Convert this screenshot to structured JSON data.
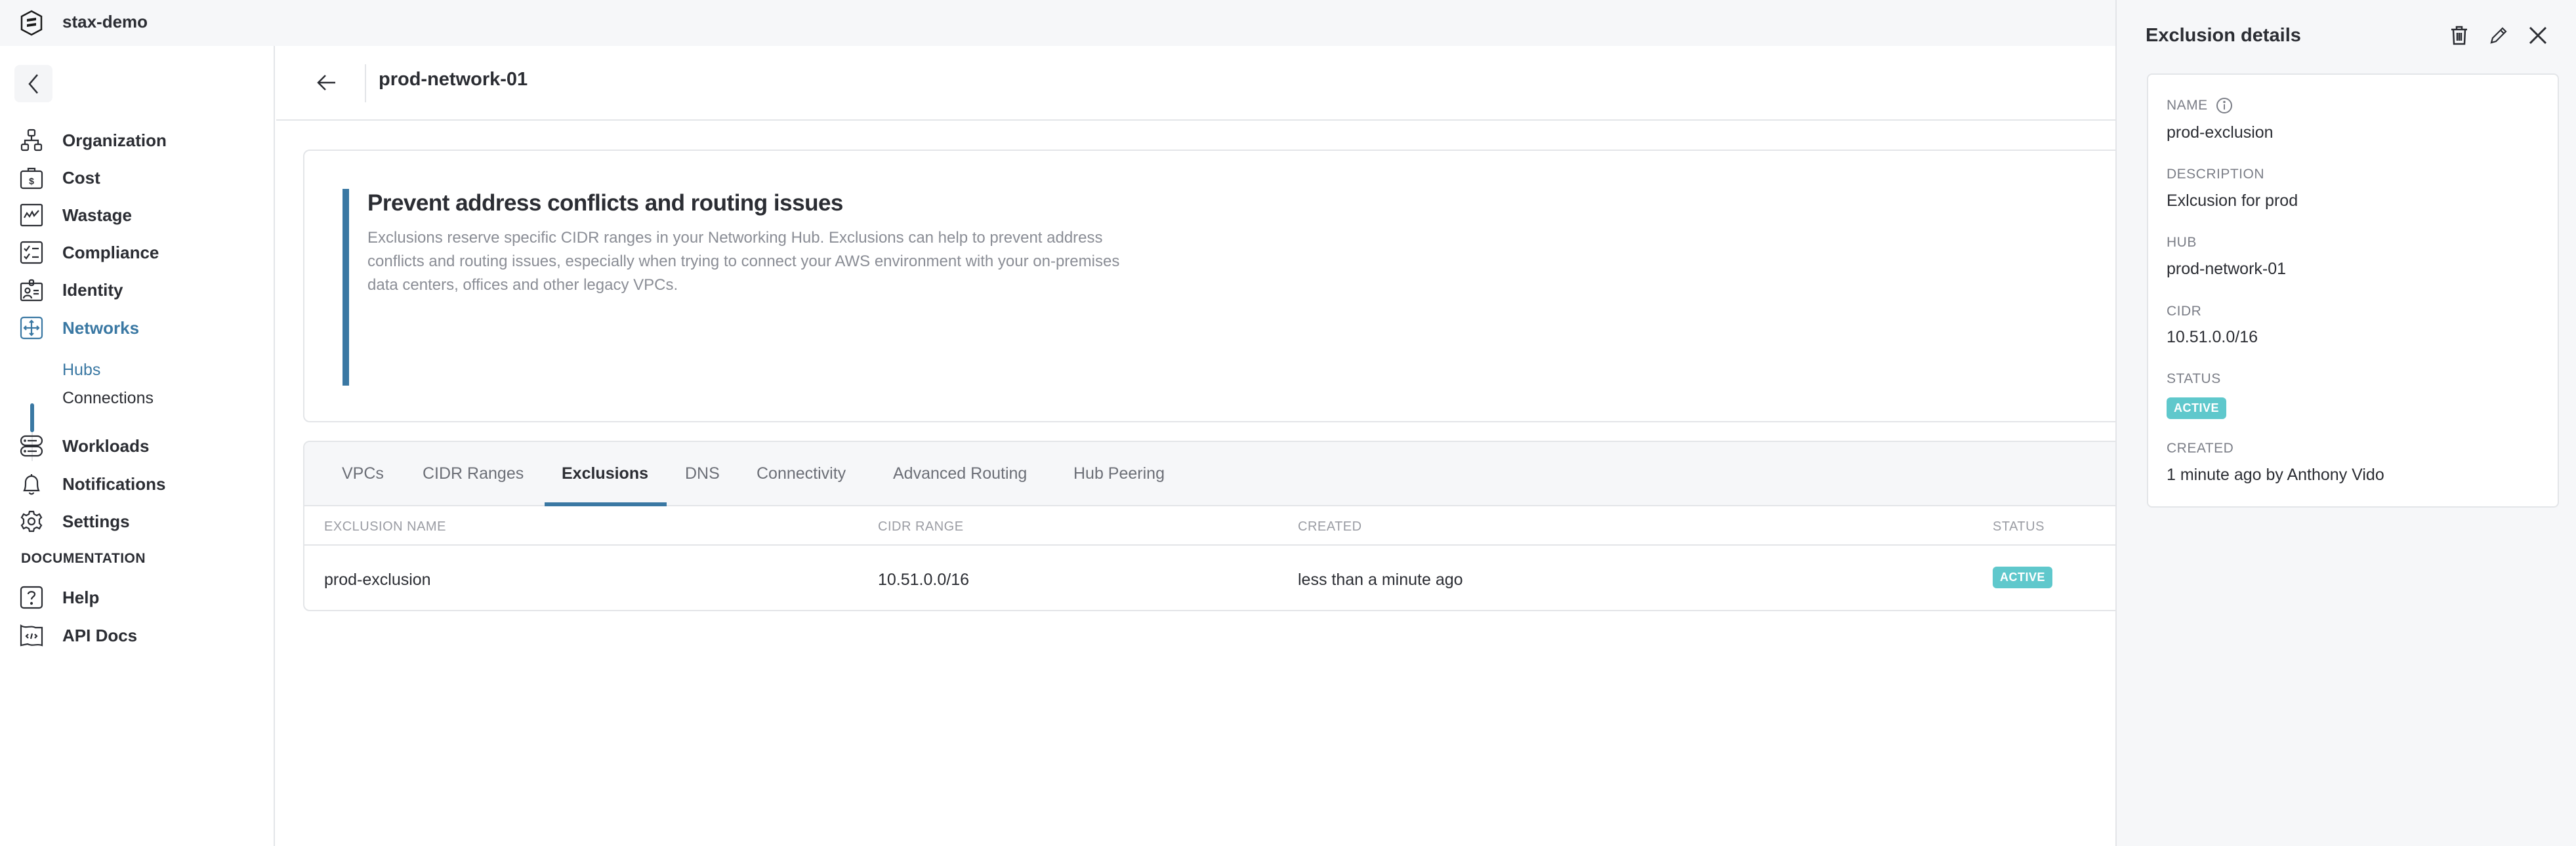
{
  "app": {
    "org_name": "stax-demo"
  },
  "sidebar": {
    "collapse_label": "Collapse sidebar",
    "items": [
      {
        "label": "Organization",
        "icon": "organization-icon"
      },
      {
        "label": "Cost",
        "icon": "cost-icon"
      },
      {
        "label": "Wastage",
        "icon": "wastage-icon"
      },
      {
        "label": "Compliance",
        "icon": "compliance-icon"
      },
      {
        "label": "Identity",
        "icon": "identity-icon"
      },
      {
        "label": "Networks",
        "icon": "networks-icon",
        "active": true
      }
    ],
    "sub_items": [
      {
        "label": "Hubs",
        "active": true
      },
      {
        "label": "Connections"
      }
    ],
    "items_lower": [
      {
        "label": "Workloads",
        "icon": "workloads-icon"
      },
      {
        "label": "Notifications",
        "icon": "bell-icon"
      },
      {
        "label": "Settings",
        "icon": "gear-icon"
      }
    ],
    "documentation_label": "DOCUMENTATION",
    "doc_items": [
      {
        "label": "Help",
        "icon": "help-icon"
      },
      {
        "label": "API Docs",
        "icon": "api-docs-icon"
      }
    ]
  },
  "header": {
    "title": "prod-network-01"
  },
  "info": {
    "title": "Prevent address conflicts and routing issues",
    "text": "Exclusions reserve specific CIDR ranges in your Networking Hub. Exclusions can help to prevent address conflicts and routing issues, especially when trying to connect your AWS environment with your on-premises data centers, offices and other legacy VPCs."
  },
  "tabs": [
    {
      "label": "VPCs"
    },
    {
      "label": "CIDR Ranges"
    },
    {
      "label": "Exclusions",
      "active": true
    },
    {
      "label": "DNS"
    },
    {
      "label": "Connectivity"
    },
    {
      "label": "Advanced Routing"
    },
    {
      "label": "Hub Peering"
    }
  ],
  "table": {
    "columns": [
      "EXCLUSION NAME",
      "CIDR RANGE",
      "CREATED",
      "STATUS"
    ],
    "rows": [
      {
        "name": "prod-exclusion",
        "cidr": "10.51.0.0/16",
        "created": "less than a minute ago",
        "status": "ACTIVE"
      }
    ]
  },
  "panel": {
    "title": "Exclusion details",
    "fields": {
      "name_label": "NAME",
      "name_value": "prod-exclusion",
      "description_label": "DESCRIPTION",
      "description_value": "Exlcusion for prod",
      "hub_label": "HUB",
      "hub_value": "prod-network-01",
      "cidr_label": "CIDR",
      "cidr_value": "10.51.0.0/16",
      "status_label": "STATUS",
      "status_value": "ACTIVE",
      "created_label": "CREATED",
      "created_value": "1 minute ago by Anthony Vido"
    }
  },
  "colors": {
    "accent": "#3a78a3",
    "status_active": "#5fc8cc",
    "background_muted": "#f6f7f9",
    "border": "#e3e5e8"
  }
}
